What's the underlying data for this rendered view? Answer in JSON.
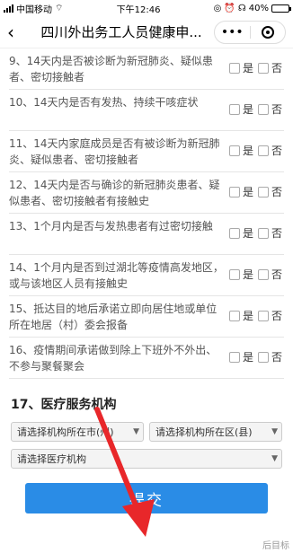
{
  "status_bar": {
    "carrier": "中国移动",
    "time": "下午12:46",
    "battery": "40%",
    "battery_level": 0.4
  },
  "nav": {
    "title": "四川外出务工人员健康申...",
    "more_glyph": "•••"
  },
  "questions": [
    {
      "text": "9、14天内是否被诊断为新冠肺炎、疑似患者、密切接触者"
    },
    {
      "text": "10、14天内是否有发热、持续干咳症状"
    },
    {
      "text": "11、14天内家庭成员是否有被诊断为新冠肺炎、疑似患者、密切接触者"
    },
    {
      "text": "12、14天内是否与确诊的新冠肺炎患者、疑似患者、密切接触者有接触史"
    },
    {
      "text": "13、1个月内是否与发热患者有过密切接触"
    },
    {
      "text": "14、1个月内是否到过湖北等疫情高发地区，或与该地区人员有接触史"
    },
    {
      "text": "15、抵达目的地后承诺立即向居住地或单位所在地居（村）委会报备"
    },
    {
      "text": "16、疫情期间承诺做到除上下班外不外出、不参与聚餐聚会"
    }
  ],
  "options": {
    "yes": "是",
    "no": "否"
  },
  "section": {
    "title": "17、医疗服务机构",
    "city_placeholder": "请选择机构所在市(州)",
    "district_placeholder": "请选择机构所在区(县)",
    "institution_placeholder": "请选择医疗机构"
  },
  "submit_label": "提交",
  "corner_text": "后目标"
}
